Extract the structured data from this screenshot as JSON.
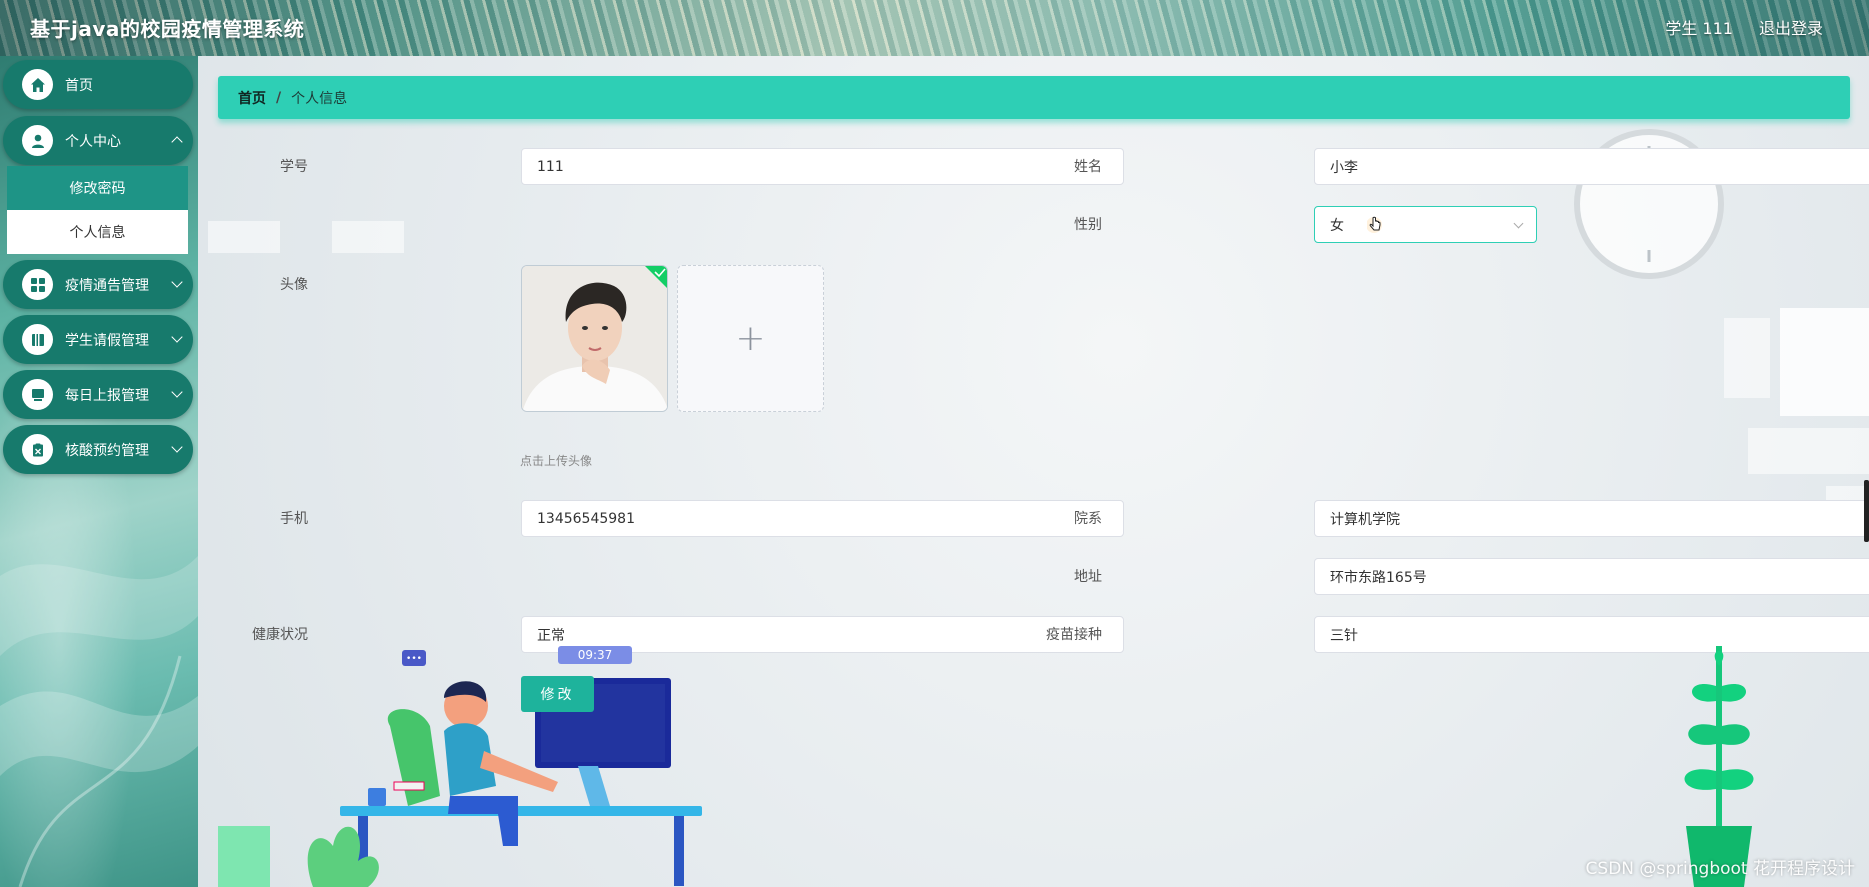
{
  "header": {
    "app_title": "基于java的校园疫情管理系统",
    "user_label": "学生 111",
    "logout_label": "退出登录"
  },
  "sidebar": {
    "items": [
      {
        "label": "首页",
        "icon": "home-icon"
      },
      {
        "label": "个人中心",
        "icon": "user-icon",
        "expanded": true
      },
      {
        "label": "疫情通告管理",
        "icon": "grid-icon"
      },
      {
        "label": "学生请假管理",
        "icon": "book-icon"
      },
      {
        "label": "每日上报管理",
        "icon": "monitor-icon"
      },
      {
        "label": "核酸预约管理",
        "icon": "clipboard-icon"
      }
    ],
    "submenu": [
      "修改密码",
      "个人信息"
    ]
  },
  "breadcrumb": {
    "home": "首页",
    "separator": "/",
    "current": "个人信息"
  },
  "form": {
    "student_id": {
      "label": "学号",
      "value": "111"
    },
    "name": {
      "label": "姓名",
      "value": "小李"
    },
    "gender": {
      "label": "性别",
      "value": "女"
    },
    "avatar": {
      "label": "头像",
      "hint": "点击上传头像",
      "add_symbol": "+"
    },
    "phone": {
      "label": "手机",
      "value": "13456545981"
    },
    "department": {
      "label": "院系",
      "value": "计算机学院"
    },
    "address": {
      "label": "地址",
      "value": "环市东路165号"
    },
    "health": {
      "label": "健康状况",
      "value": "正常"
    },
    "vaccine": {
      "label": "疫苗接种",
      "value": "三针"
    },
    "submit_label": "修改"
  },
  "illustration": {
    "clock_text": "09:37",
    "chat_text": "•••"
  },
  "watermark": "CSDN @springboot 花开程序设计",
  "colors": {
    "accent": "#2ecfb5",
    "sidebar_item": "#177a6c",
    "button": "#1eb39c"
  }
}
